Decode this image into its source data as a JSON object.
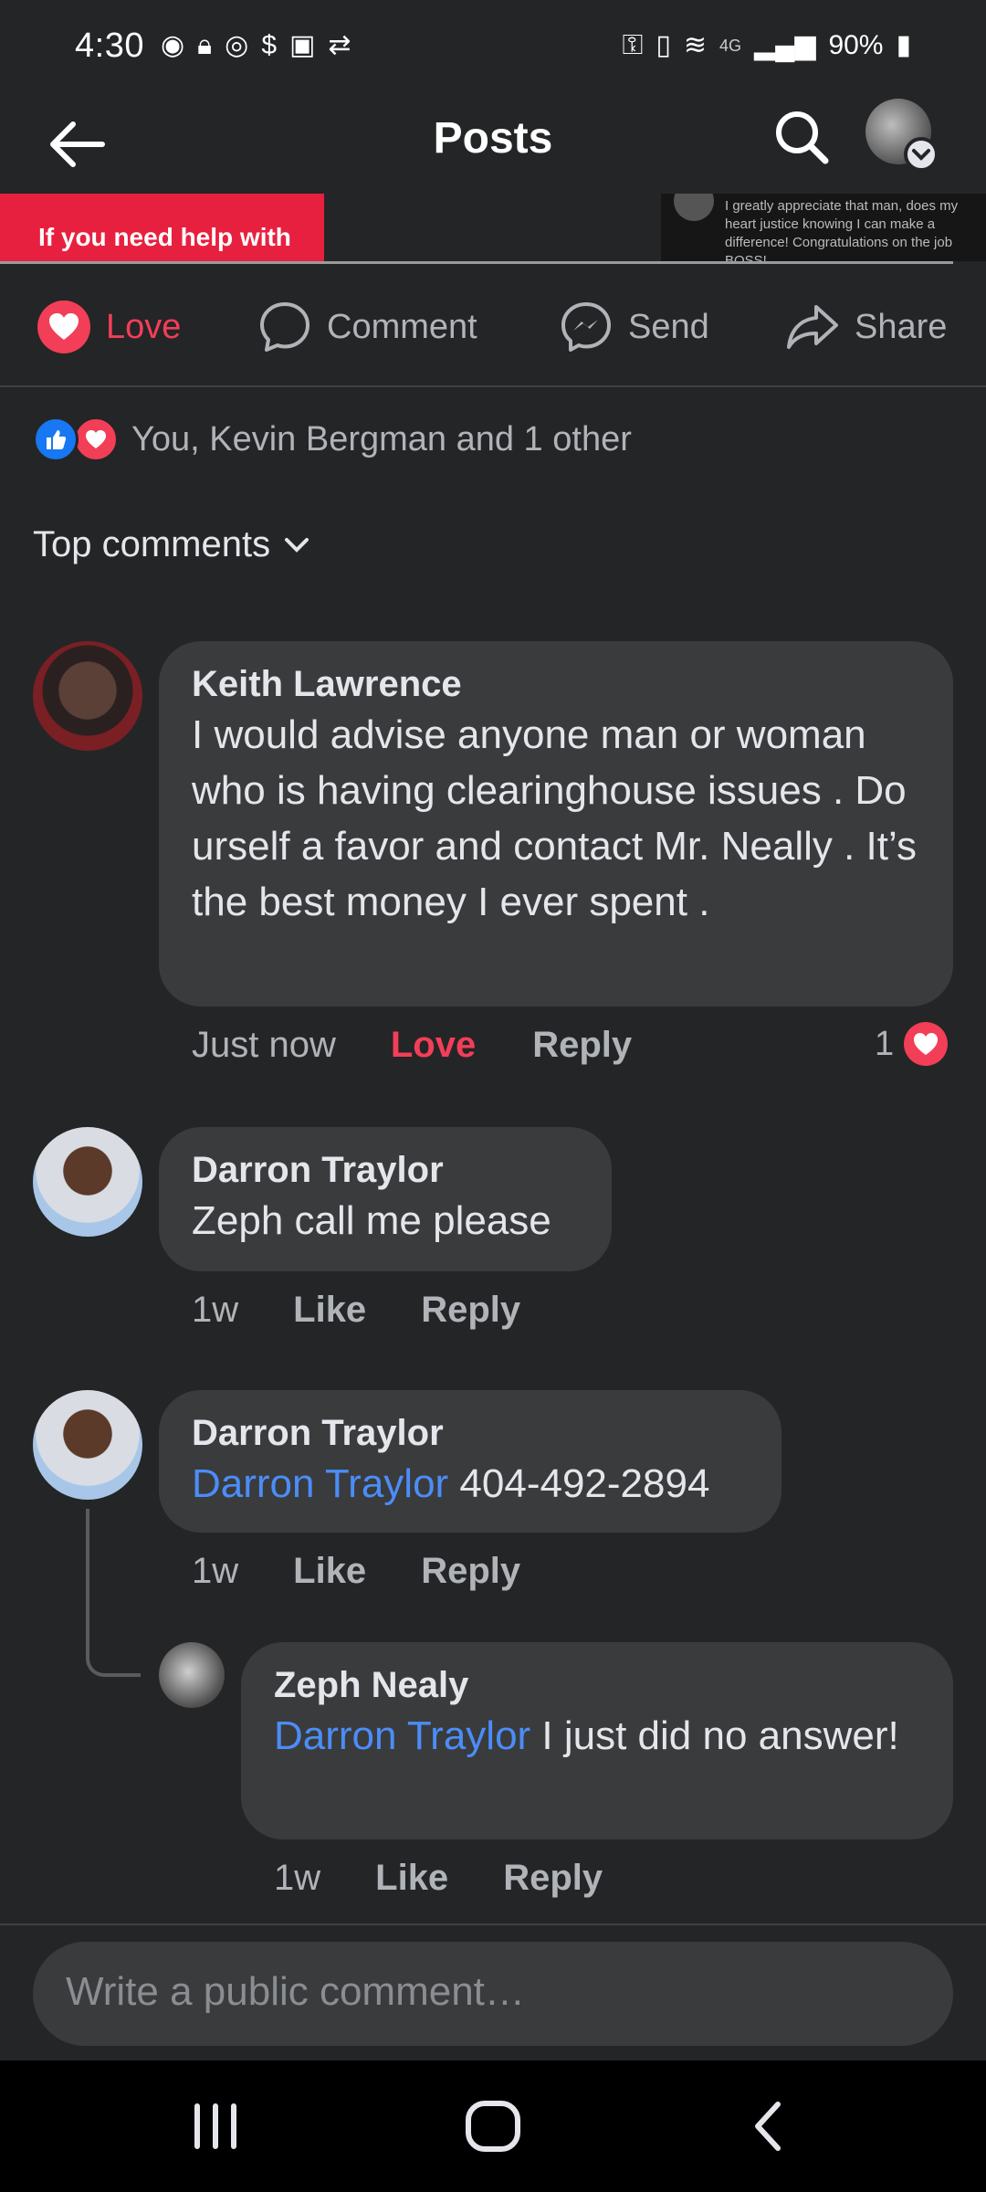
{
  "status_bar": {
    "time": "4:30",
    "battery": "90%",
    "network": "4G"
  },
  "header": {
    "title": "Posts"
  },
  "post_preview": {
    "left_text": "If you need help with",
    "right_text": "I greatly appreciate that man, does my heart justice knowing I can make a difference! Congratulations on the job BOSS!"
  },
  "actions": {
    "love": "Love",
    "comment": "Comment",
    "send": "Send",
    "share": "Share"
  },
  "reactions": {
    "summary": "You, Kevin Bergman and 1 other"
  },
  "sort": {
    "label": "Top comments"
  },
  "comments": [
    {
      "author": "Keith Lawrence",
      "text": "I would advise anyone man or woman who is having clearinghouse issues . Do urself a favor and contact Mr. Neally . It’s the best money I ever spent .",
      "time": "Just now",
      "reaction_label": "Love",
      "reply_label": "Reply",
      "reaction_count": "1"
    },
    {
      "author": "Darron Traylor",
      "text": "Zeph call me please",
      "time": "1w",
      "like_label": "Like",
      "reply_label": "Reply"
    },
    {
      "author": "Darron Traylor",
      "mention": "Darron Traylor",
      "text": " 404-492-2894",
      "time": "1w",
      "like_label": "Like",
      "reply_label": "Reply"
    },
    {
      "author": "Zeph Nealy",
      "mention": "Darron Traylor",
      "text": " I just did no answer!",
      "time": "1w",
      "like_label": "Like",
      "reply_label": "Reply"
    }
  ],
  "composer": {
    "placeholder": "Write a public comment…"
  },
  "colors": {
    "background": "#242526",
    "bubble": "#3a3b3c",
    "love": "#f33e58",
    "mention": "#4b8df8",
    "like_blue": "#1877f2"
  }
}
